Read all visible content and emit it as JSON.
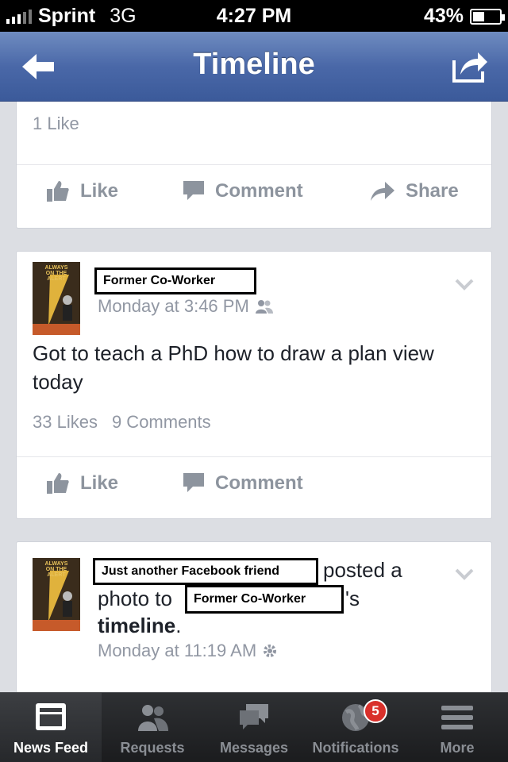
{
  "status_bar": {
    "carrier": "Sprint",
    "network": "3G",
    "time": "4:27 PM",
    "battery": "43%",
    "battery_level": 0.43
  },
  "nav": {
    "title": "Timeline",
    "back_icon": "back-arrow-icon",
    "share_icon": "share-icon"
  },
  "post_prev": {
    "likes": "1 Like",
    "actions": {
      "like": "Like",
      "comment": "Comment",
      "share": "Share"
    }
  },
  "post_1": {
    "author": "Former Co-Worker",
    "time": "Monday at 3:46 PM",
    "text": "Got to teach a PhD how to draw a plan view today",
    "likes": "33 Likes",
    "comments": "9 Comments",
    "actions": {
      "like": "Like",
      "comment": "Comment"
    }
  },
  "post_2": {
    "author": "Just another Facebook friend",
    "verb": "posted a",
    "line2_prefix": "photo to",
    "target": "Former Co-Worker",
    "possessive": "'s",
    "timeline_word": "timeline",
    "period": ".",
    "time": "Monday at 11:19 AM"
  },
  "tabs": [
    {
      "label": "News Feed",
      "icon": "news-feed-icon",
      "active": true
    },
    {
      "label": "Requests",
      "icon": "requests-icon"
    },
    {
      "label": "Messages",
      "icon": "messages-icon"
    },
    {
      "label": "Notifications",
      "icon": "notifications-icon",
      "badge": "5"
    },
    {
      "label": "More",
      "icon": "more-icon"
    }
  ],
  "colors": {
    "nav_blue": "#4a68a8",
    "badge_red": "#d9302b",
    "action_gray": "#8d949e"
  }
}
